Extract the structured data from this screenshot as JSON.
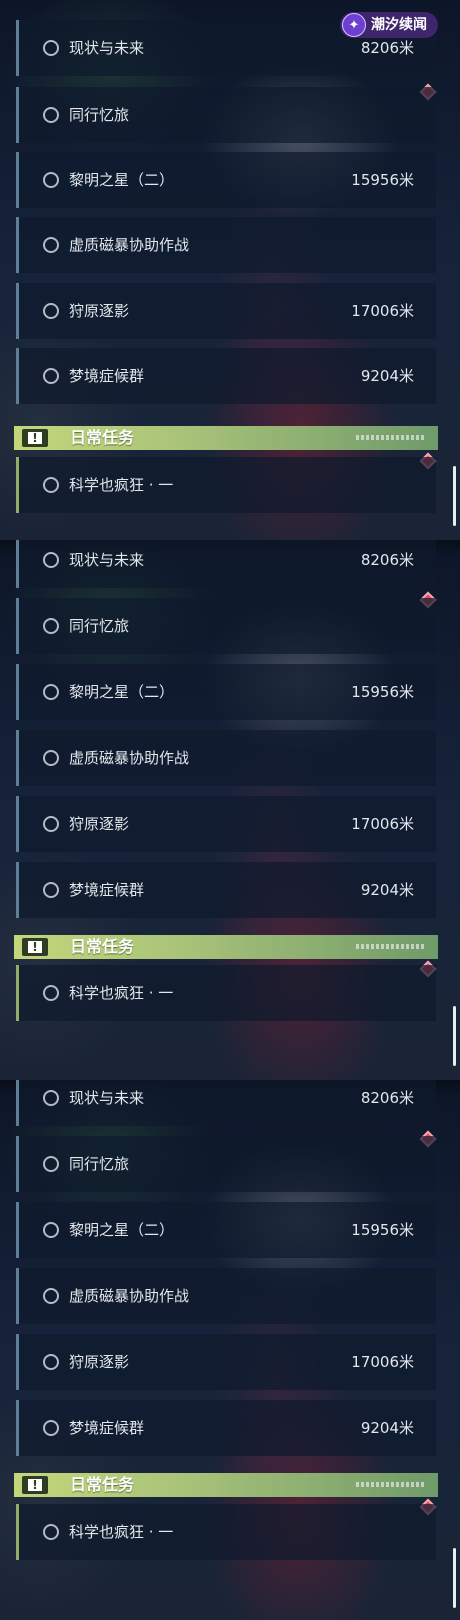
{
  "watermark": {
    "text": "潮汐续闻",
    "icon": "wave-logo-icon"
  },
  "colors": {
    "badge": "#d65063",
    "daily_accent": "#a9c379",
    "row_border": "#5f7f96"
  },
  "panels": [
    {
      "quests": [
        {
          "name": "现状与未来",
          "distance": "8206米"
        },
        {
          "name": "同行忆旅",
          "distance": ""
        },
        {
          "name": "黎明之星（二）",
          "distance": "15956米"
        },
        {
          "name": "虚质磁暴协助作战",
          "distance": ""
        },
        {
          "name": "狩原逐影",
          "distance": "17006米"
        },
        {
          "name": "梦境症候群",
          "distance": "9204米"
        }
      ],
      "section": {
        "title": "日常任务"
      },
      "daily": [
        {
          "name": "科学也疯狂 · 一",
          "distance": ""
        }
      ]
    },
    {
      "quests": [
        {
          "name": "现状与未来",
          "distance": "8206米"
        },
        {
          "name": "同行忆旅",
          "distance": ""
        },
        {
          "name": "黎明之星（二）",
          "distance": "15956米"
        },
        {
          "name": "虚质磁暴协助作战",
          "distance": ""
        },
        {
          "name": "狩原逐影",
          "distance": "17006米"
        },
        {
          "name": "梦境症候群",
          "distance": "9204米"
        }
      ],
      "section": {
        "title": "日常任务"
      },
      "daily": [
        {
          "name": "科学也疯狂 · 一",
          "distance": ""
        }
      ]
    },
    {
      "quests": [
        {
          "name": "现状与未来",
          "distance": "8206米"
        },
        {
          "name": "同行忆旅",
          "distance": ""
        },
        {
          "name": "黎明之星（二）",
          "distance": "15956米"
        },
        {
          "name": "虚质磁暴协助作战",
          "distance": ""
        },
        {
          "name": "狩原逐影",
          "distance": "17006米"
        },
        {
          "name": "梦境症候群",
          "distance": "9204米"
        }
      ],
      "section": {
        "title": "日常任务"
      },
      "daily": [
        {
          "name": "科学也疯狂 · 一",
          "distance": ""
        }
      ]
    }
  ]
}
